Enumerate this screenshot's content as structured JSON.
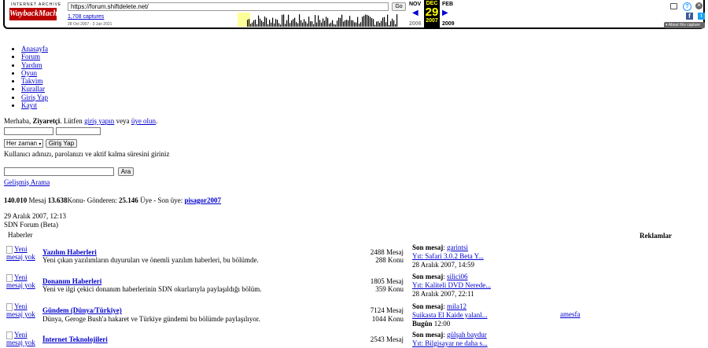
{
  "wayback": {
    "logo_top": "INTERNET ARCHIVE",
    "logo_main": "WaybackMachine",
    "url": "https://forum.shiftdelete.net/",
    "go_label": "Go",
    "captures": "1,708 captures",
    "range": "28 Oct 2007 - 3 Jan 2021",
    "prev_month": "NOV",
    "cur_month": "DEC",
    "cur_day": "29",
    "cur_year": "2007",
    "next_month": "FEB",
    "prev_year": "2006",
    "next_year": "2009",
    "about": "▾ About this capture"
  },
  "nav": [
    "Anasayfa",
    "Forum",
    "Yardım",
    "Oyun",
    "Takvim",
    "Kurallar",
    "Giriş Yap",
    "Kayıt"
  ],
  "login": {
    "greeting_pre": "Merhaba,",
    "guest": "Ziyaretçi",
    "greeting_mid": ". Lütfen",
    "login_link": "giriş yapın",
    "or": "veya",
    "register_link": "üye olun",
    "period": ".",
    "remember_option": "Her zaman",
    "login_button": "Giriş Yap",
    "hint": "Kullanıcı adınızı, parolanızı ve aktif kalma süresini giriniz"
  },
  "search": {
    "button": "Ara",
    "advanced": "Gelişmiş Arama"
  },
  "stats": {
    "posts": "140.010",
    "posts_label": "Mesaj",
    "topics": "13.638",
    "topics_label": "Konu- Gönderen:",
    "members": "25.146",
    "members_label": "Üye - Son üye:",
    "last_member": "pisagor2007"
  },
  "date": "29 Aralık 2007, 12:13",
  "forum_title": "SDN Forum (Beta)",
  "section": "Haberler",
  "ads": "Reklamlar",
  "ad_link": "amesfa",
  "forums": [
    {
      "icon_alt": "Yeni mesaj yok",
      "title": "Yazılım Haberleri",
      "desc": "Yeni çıkan yazılımların duyuruları ve önemli yazılım haberleri, bu bölümde.",
      "posts": "2488 Mesaj",
      "topics": "288 Konu",
      "last_label": "Son mesaj",
      "last_user": "garintsi",
      "last_topic": "Yıt: Safari 3.0.2 Beta Y...",
      "last_date": "28 Aralık 2007, 14:59"
    },
    {
      "icon_alt": "Yeni mesaj yok",
      "title": "Donanım Haberleri",
      "desc": "Yeni ve ilgi çekici donanım haberlerinin SDN okurlarıyla paylaşıldığı bölüm.",
      "posts": "1805 Mesaj",
      "topics": "359 Konu",
      "last_label": "Son mesaj",
      "last_user": "silici06",
      "last_topic": "Yıt: Kaliteli DVD Nerede...",
      "last_date": "28 Aralık 2007, 22:11"
    },
    {
      "icon_alt": "Yeni mesaj yok",
      "title": "Gündem (Dünya/Türkiye)",
      "desc": "Dünya, Geroge Bush'a hakaret ve Türkiye gündemi bu bölümde paylaşılıyor.",
      "posts": "7124 Mesaj",
      "topics": "1044 Konu",
      "last_label": "Son mesaj",
      "last_user": "mila12",
      "last_topic": "Suikasta El Kaide yalanl...",
      "last_date_bold": "Bugün",
      "last_date": "12:00"
    },
    {
      "icon_alt": "Yeni mesaj yok",
      "title": "İnternet Teknolojileri",
      "desc": "",
      "posts": "2543 Mesaj",
      "topics": "",
      "last_label": "Son mesaj",
      "last_user": "gülşah baydur",
      "last_topic": "Yıt: Bilgisayar ne daha s...",
      "last_date": ""
    }
  ],
  "colors": {
    "link": "#0000cc",
    "wayback_red": "#bb0000",
    "calendar_bg": "#000000",
    "calendar_fg": "#ffff00"
  }
}
